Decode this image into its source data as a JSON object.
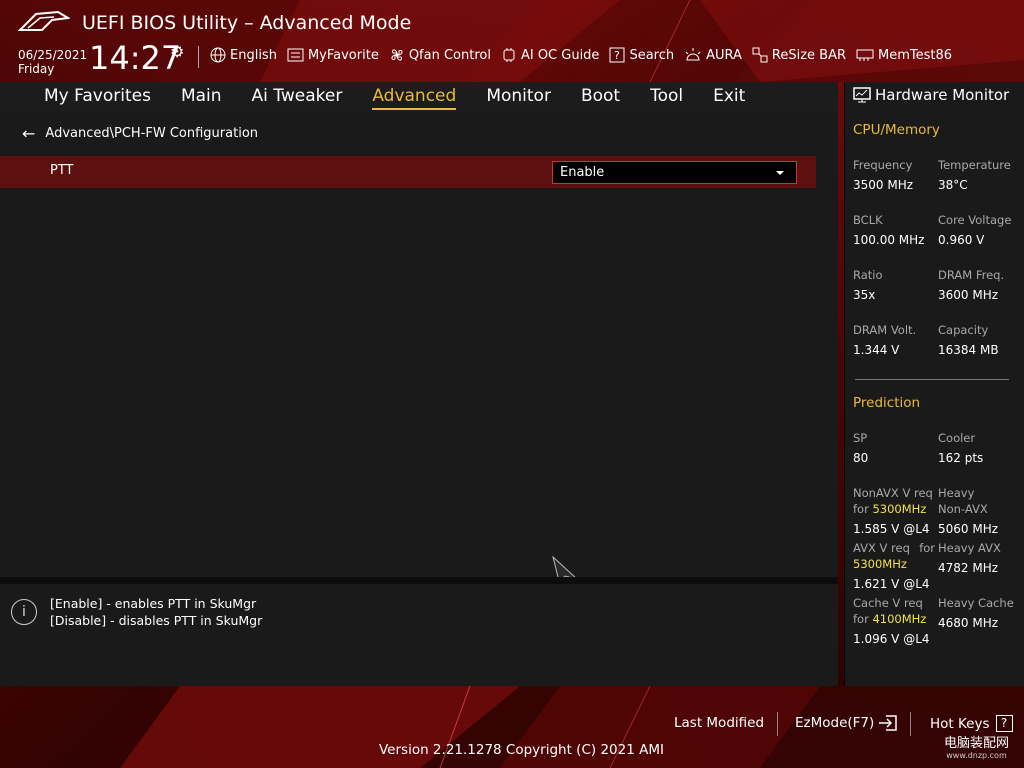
{
  "header": {
    "title": "UEFI BIOS Utility – Advanced Mode",
    "date": "06/25/2021",
    "day": "Friday",
    "time": "14:27",
    "tools": [
      {
        "label": "English",
        "icon": "globe-icon"
      },
      {
        "label": "MyFavorite",
        "icon": "favorite-list-icon"
      },
      {
        "label": "Qfan Control",
        "icon": "fan-icon"
      },
      {
        "label": "AI OC Guide",
        "icon": "ai-oc-icon"
      },
      {
        "label": "Search",
        "icon": "search-help-icon"
      },
      {
        "label": "AURA",
        "icon": "aura-light-icon"
      },
      {
        "label": "ReSize BAR",
        "icon": "resize-bar-icon"
      },
      {
        "label": "MemTest86",
        "icon": "memory-icon"
      }
    ]
  },
  "nav": {
    "tabs": [
      "My Favorites",
      "Main",
      "Ai Tweaker",
      "Advanced",
      "Monitor",
      "Boot",
      "Tool",
      "Exit"
    ],
    "active": "Advanced"
  },
  "main": {
    "breadcrumb": "Advanced\\PCH-FW Configuration",
    "settings": [
      {
        "label": "PTT",
        "value": "Enable"
      }
    ]
  },
  "help": {
    "lines": [
      "[Enable] - enables PTT in SkuMgr",
      "[Disable] - disables PTT in SkuMgr"
    ]
  },
  "hardware_monitor": {
    "title": "Hardware Monitor",
    "cpu_memory": {
      "title": "CPU/Memory",
      "items": [
        {
          "label": "Frequency",
          "value": "3500 MHz"
        },
        {
          "label": "Temperature",
          "value": "38°C"
        },
        {
          "label": "BCLK",
          "value": "100.00 MHz"
        },
        {
          "label": "Core Voltage",
          "value": "0.960 V"
        },
        {
          "label": "Ratio",
          "value": "35x"
        },
        {
          "label": "DRAM Freq.",
          "value": "3600 MHz"
        },
        {
          "label": "DRAM Volt.",
          "value": "1.344 V"
        },
        {
          "label": "Capacity",
          "value": "16384 MB"
        }
      ]
    },
    "prediction": {
      "title": "Prediction",
      "sp_label": "SP",
      "sp_value": "80",
      "cooler_label": "Cooler",
      "cooler_value": "162 pts",
      "nonavx_label": "NonAVX V req",
      "nonavx_for": "for",
      "nonavx_freq": "5300MHz",
      "nonavx_value": "1.585 V @L4",
      "heavy_nonavx_label1": "Heavy",
      "heavy_nonavx_label2": "Non-AVX",
      "heavy_nonavx_value": "5060 MHz",
      "avx_label": "AVX V req",
      "avx_for": "for",
      "avx_freq": "5300MHz",
      "avx_value": "1.621 V @L4",
      "heavy_avx_label": "Heavy AVX",
      "heavy_avx_value": "4782 MHz",
      "cache_label": "Cache V req",
      "cache_for": "for",
      "cache_freq": "4100MHz",
      "cache_value": "1.096 V @L4",
      "heavy_cache_label": "Heavy Cache",
      "heavy_cache_value": "4680 MHz"
    }
  },
  "footer": {
    "last_modified": "Last Modified",
    "ezmode": "EzMode(F7)",
    "hotkeys": "Hot Keys",
    "hotkeys_key": "?",
    "version": "Version 2.21.1278 Copyright (C) 2021 AMI"
  },
  "watermark": {
    "line1": "电脑装配网",
    "line2": "www.dnzp.com"
  },
  "colors": {
    "accent": "#e8b93c",
    "highlight_row": "#5e1010",
    "value_yellow": "#f0e14a"
  }
}
